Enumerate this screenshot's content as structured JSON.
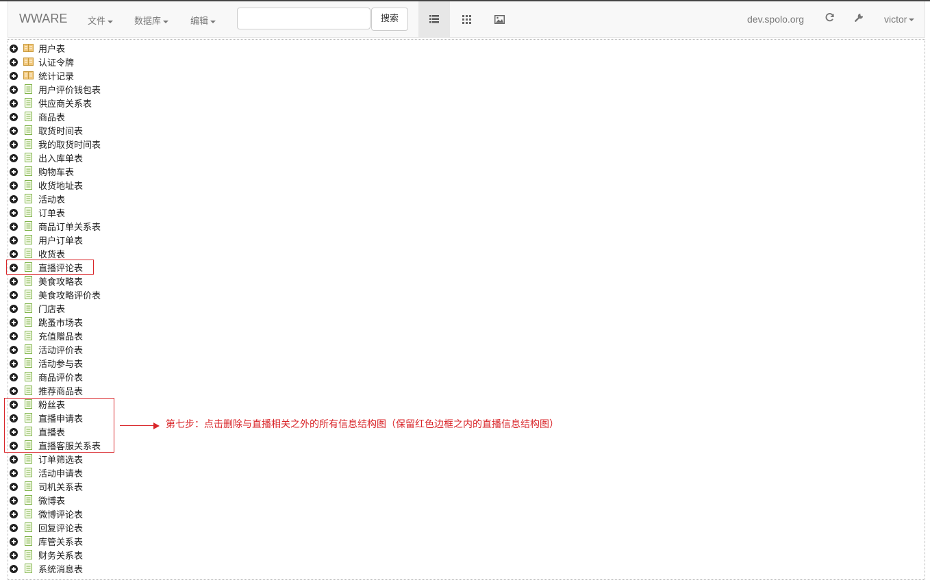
{
  "navbar": {
    "brand": "WWARE",
    "menus": [
      {
        "label": "文件"
      },
      {
        "label": "数据库"
      },
      {
        "label": "编辑"
      }
    ],
    "search": {
      "placeholder": "",
      "button_label": "搜索"
    },
    "view_modes": [
      {
        "icon": "list-view-icon",
        "active": true
      },
      {
        "icon": "grid-view-icon",
        "active": false
      },
      {
        "icon": "image-view-icon",
        "active": false
      }
    ],
    "host": "dev.spolo.org",
    "refresh_icon": "refresh-icon",
    "settings_icon": "wrench-icon",
    "user": "victor"
  },
  "tree": {
    "items": [
      {
        "label": "用户表",
        "icon": "folder-table-icon"
      },
      {
        "label": "认证令牌",
        "icon": "folder-table-icon"
      },
      {
        "label": "统计记录",
        "icon": "folder-table-icon"
      },
      {
        "label": "用户评价钱包表",
        "icon": "document-icon"
      },
      {
        "label": "供应商关系表",
        "icon": "document-icon"
      },
      {
        "label": "商品表",
        "icon": "document-icon"
      },
      {
        "label": "取货时间表",
        "icon": "document-icon"
      },
      {
        "label": "我的取货时间表",
        "icon": "document-icon"
      },
      {
        "label": "出入库单表",
        "icon": "document-icon"
      },
      {
        "label": "购物车表",
        "icon": "document-icon"
      },
      {
        "label": "收货地址表",
        "icon": "document-icon"
      },
      {
        "label": "活动表",
        "icon": "document-icon"
      },
      {
        "label": "订单表",
        "icon": "document-icon"
      },
      {
        "label": "商品订单关系表",
        "icon": "document-icon"
      },
      {
        "label": "用户订单表",
        "icon": "document-icon"
      },
      {
        "label": "收货表",
        "icon": "document-icon"
      },
      {
        "label": "直播评论表",
        "icon": "document-icon"
      },
      {
        "label": "美食攻略表",
        "icon": "document-icon"
      },
      {
        "label": "美食攻略评价表",
        "icon": "document-icon"
      },
      {
        "label": "门店表",
        "icon": "document-icon"
      },
      {
        "label": "跳蚤市场表",
        "icon": "document-icon"
      },
      {
        "label": "充值赠品表",
        "icon": "document-icon"
      },
      {
        "label": "活动评价表",
        "icon": "document-icon"
      },
      {
        "label": "活动参与表",
        "icon": "document-icon"
      },
      {
        "label": "商品评价表",
        "icon": "document-icon"
      },
      {
        "label": "推荐商品表",
        "icon": "document-icon"
      },
      {
        "label": "粉丝表",
        "icon": "document-icon"
      },
      {
        "label": "直播申请表",
        "icon": "document-icon"
      },
      {
        "label": "直播表",
        "icon": "document-icon"
      },
      {
        "label": "直播客服关系表",
        "icon": "document-icon"
      },
      {
        "label": "订单筛选表",
        "icon": "document-icon"
      },
      {
        "label": "活动申请表",
        "icon": "document-icon"
      },
      {
        "label": "司机关系表",
        "icon": "document-icon"
      },
      {
        "label": "微博表",
        "icon": "document-icon"
      },
      {
        "label": "微博评论表",
        "icon": "document-icon"
      },
      {
        "label": "回复评论表",
        "icon": "document-icon"
      },
      {
        "label": "库管关系表",
        "icon": "document-icon"
      },
      {
        "label": "财务关系表",
        "icon": "document-icon"
      },
      {
        "label": "系统消息表",
        "icon": "document-icon"
      }
    ]
  },
  "annotation": {
    "text": "第七步：点击删除与直播相关之外的所有信息结构图（保留红色边框之内的直播信息结构图）",
    "color": "#d9262a"
  }
}
